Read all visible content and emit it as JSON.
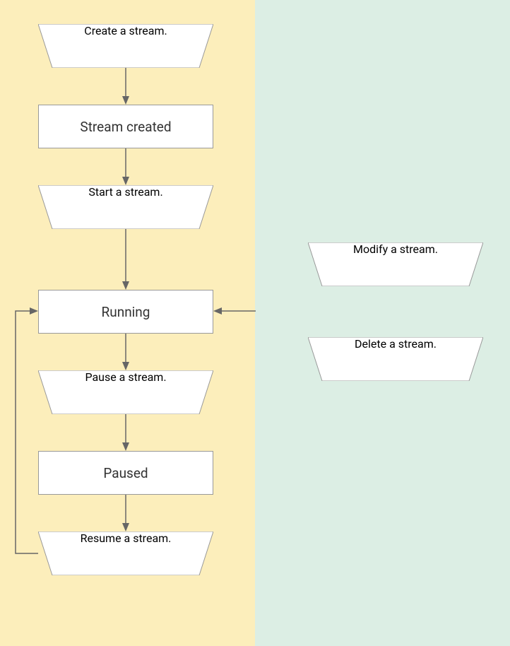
{
  "flowchart": {
    "nodes": {
      "create_stream": "Create a stream.",
      "stream_created": "Stream created",
      "start_stream": "Start a stream.",
      "running": "Running",
      "pause_stream": "Pause a stream.",
      "paused": "Paused",
      "resume_stream": "Resume a stream.",
      "modify_stream": "Modify a stream.",
      "delete_stream": "Delete a stream."
    }
  },
  "chart_data": {
    "type": "flowchart",
    "title": "",
    "panels": [
      {
        "side": "left",
        "color": "#fceebb"
      },
      {
        "side": "right",
        "color": "#dceee4"
      }
    ],
    "nodes": [
      {
        "id": "create_stream",
        "label": "Create a stream.",
        "shape": "trapezoid",
        "panel": "left"
      },
      {
        "id": "stream_created",
        "label": "Stream created",
        "shape": "rectangle",
        "panel": "left"
      },
      {
        "id": "start_stream",
        "label": "Start a stream.",
        "shape": "trapezoid",
        "panel": "left"
      },
      {
        "id": "running",
        "label": "Running",
        "shape": "rectangle",
        "panel": "left"
      },
      {
        "id": "pause_stream",
        "label": "Pause a stream.",
        "shape": "trapezoid",
        "panel": "left"
      },
      {
        "id": "paused",
        "label": "Paused",
        "shape": "rectangle",
        "panel": "left"
      },
      {
        "id": "resume_stream",
        "label": "Resume a stream.",
        "shape": "trapezoid",
        "panel": "left"
      },
      {
        "id": "modify_stream",
        "label": "Modify a stream.",
        "shape": "trapezoid",
        "panel": "right"
      },
      {
        "id": "delete_stream",
        "label": "Delete a stream.",
        "shape": "trapezoid",
        "panel": "right"
      }
    ],
    "edges": [
      {
        "from": "create_stream",
        "to": "stream_created"
      },
      {
        "from": "stream_created",
        "to": "start_stream"
      },
      {
        "from": "start_stream",
        "to": "running"
      },
      {
        "from": "running",
        "to": "pause_stream"
      },
      {
        "from": "pause_stream",
        "to": "paused"
      },
      {
        "from": "paused",
        "to": "resume_stream"
      },
      {
        "from": "resume_stream",
        "to": "running",
        "loop": true
      },
      {
        "from": "right_panel",
        "to": "running"
      }
    ]
  }
}
